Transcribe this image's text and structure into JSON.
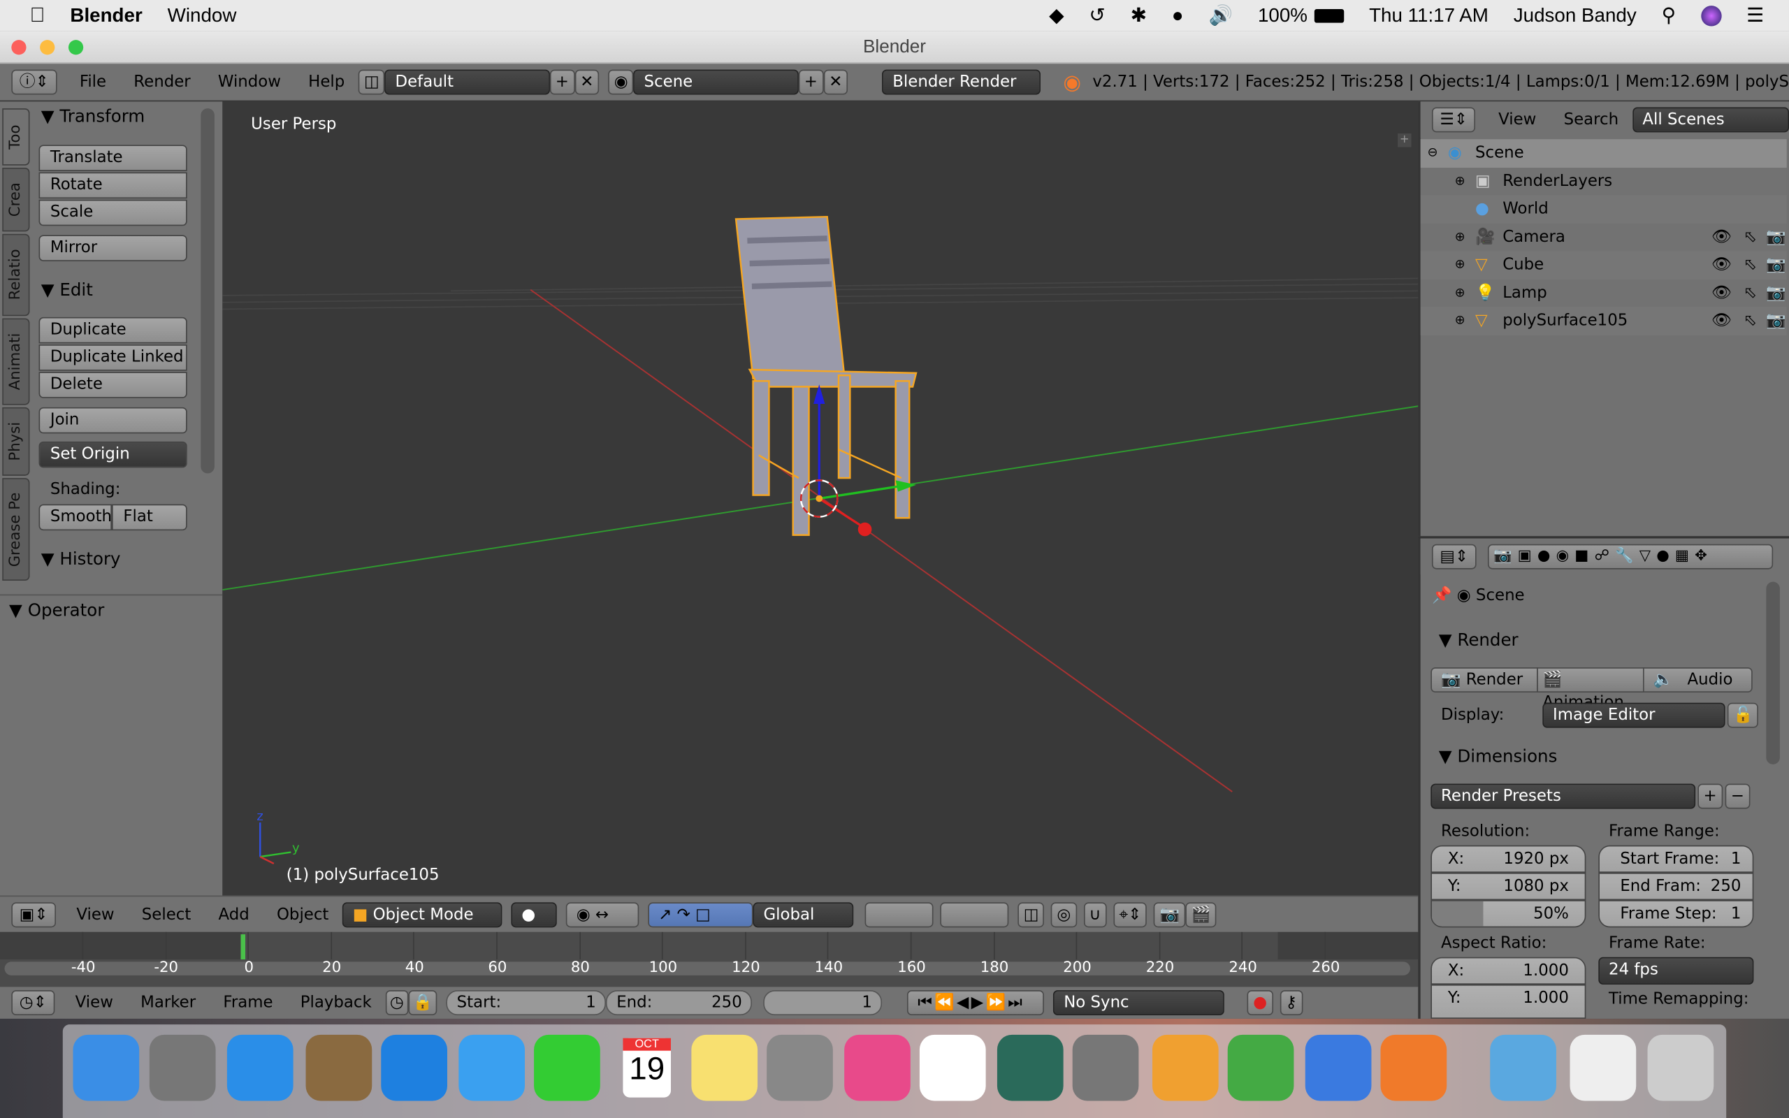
{
  "mac_menubar": {
    "app": "Blender",
    "menu": "Window",
    "battery": "100%",
    "clock": "Thu 11:17 AM",
    "user": "Judson Bandy"
  },
  "window": {
    "title": "Blender"
  },
  "info_header": {
    "menus": [
      "File",
      "Render",
      "Window",
      "Help"
    ],
    "layout": "Default",
    "scene": "Scene",
    "engine": "Blender Render",
    "stats": "v2.71 | Verts:172 | Faces:252 | Tris:258 | Objects:1/4 | Lamps:0/1 | Mem:12.69M | polyS"
  },
  "toolshelf": {
    "tabs": [
      "Too",
      "Crea",
      "Relatio",
      "Animati",
      "Physi",
      "Grease Pe"
    ],
    "transform": {
      "title": "Transform",
      "buttons": [
        "Translate",
        "Rotate",
        "Scale",
        "Mirror"
      ]
    },
    "edit": {
      "title": "Edit",
      "buttons": [
        "Duplicate",
        "Duplicate Linked",
        "Delete",
        "Join"
      ],
      "set_origin": "Set Origin",
      "shading_label": "Shading:",
      "smooth": "Smooth",
      "flat": "Flat"
    },
    "history": {
      "title": "History"
    },
    "operator": {
      "title": "Operator"
    }
  },
  "viewport": {
    "view_label": "User Persp",
    "object_label": "(1) polySurface105",
    "axis_x": "x",
    "axis_y": "y",
    "axis_z": "z",
    "header": {
      "menus": [
        "View",
        "Select",
        "Add",
        "Object"
      ],
      "mode": "Object Mode",
      "orientation": "Global"
    }
  },
  "timeline": {
    "ticks": [
      "-40",
      "-20",
      "0",
      "20",
      "40",
      "60",
      "80",
      "100",
      "120",
      "140",
      "160",
      "180",
      "200",
      "220",
      "240",
      "260"
    ],
    "current_frame": 1,
    "header": {
      "menus": [
        "View",
        "Marker",
        "Frame",
        "Playback"
      ],
      "start_label": "Start:",
      "start": "1",
      "end_label": "End:",
      "end": "250",
      "current": "1",
      "sync": "No Sync"
    }
  },
  "outliner": {
    "menus": [
      "View",
      "Search"
    ],
    "filter": "All Scenes",
    "items": [
      {
        "name": "Scene"
      },
      {
        "name": "RenderLayers"
      },
      {
        "name": "World"
      },
      {
        "name": "Camera"
      },
      {
        "name": "Cube"
      },
      {
        "name": "Lamp"
      },
      {
        "name": "polySurface105"
      }
    ]
  },
  "properties": {
    "context": "Scene",
    "render": {
      "title": "Render",
      "buttons": [
        "Render",
        "Animation",
        "Audio"
      ],
      "display_label": "Display:",
      "display": "Image Editor"
    },
    "dimensions": {
      "title": "Dimensions",
      "presets": "Render Presets",
      "resolution_label": "Resolution:",
      "res_x": "1920 px",
      "res_y": "1080 px",
      "res_pct": "50%",
      "res_pct_value": 50,
      "frame_range_label": "Frame Range:",
      "start_frame": "Start Frame:",
      "start_val": "1",
      "end_frame": "End Fram:",
      "end_val": "250",
      "frame_step": "Frame Step:",
      "step_val": "1",
      "aspect_label": "Aspect Ratio:",
      "asp_x": "1.000",
      "asp_y": "1.000",
      "frame_rate_label": "Frame Rate:",
      "fps": "24 fps",
      "time_remap": "Time Remapping:"
    }
  },
  "dock": {
    "calendar_month": "OCT",
    "calendar_day": "19",
    "apps": [
      "Finder",
      "Launchpad",
      "App Store",
      "Preview",
      "Safari",
      "Messages",
      "FaceTime",
      "Calendar",
      "Notes",
      "Image Capture",
      "iTunes",
      "Photos",
      "Time Machine",
      "System Preferences",
      "Pages",
      "Numbers",
      "Xcode",
      "Blender",
      "Applications",
      "Documents",
      "Trash"
    ]
  },
  "colors": {
    "viewport_bg": "#393939",
    "panel_bg": "#727272",
    "selection": "#f5a623",
    "x_axis": "#c43030",
    "y_axis": "#2fa22f"
  }
}
